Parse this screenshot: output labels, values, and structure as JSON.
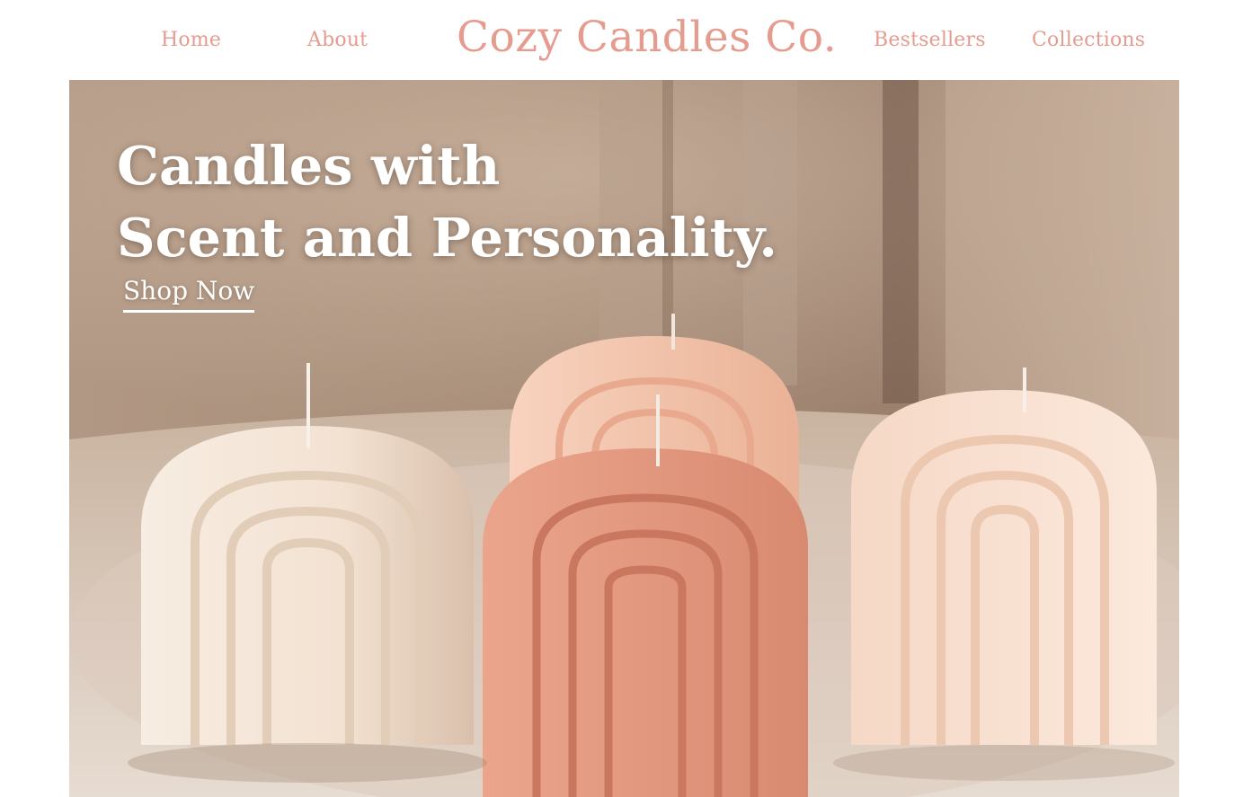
{
  "nav": {
    "home": "Home",
    "about": "About",
    "brand": "Cozy Candles Co.",
    "bestsellers": "Bestsellers",
    "collections": "Collections"
  },
  "hero": {
    "headline_line1": "Candles with",
    "headline_line2": "Scent and Personality.",
    "cta": "Shop Now",
    "image_subject": "arch-candles-photo"
  },
  "colors": {
    "brand": "#e59c8f",
    "hero_text": "#ffffff",
    "candle_cream": "#f3e4d6",
    "candle_peach": "#f2bfa6",
    "candle_terracotta": "#e0957c"
  }
}
